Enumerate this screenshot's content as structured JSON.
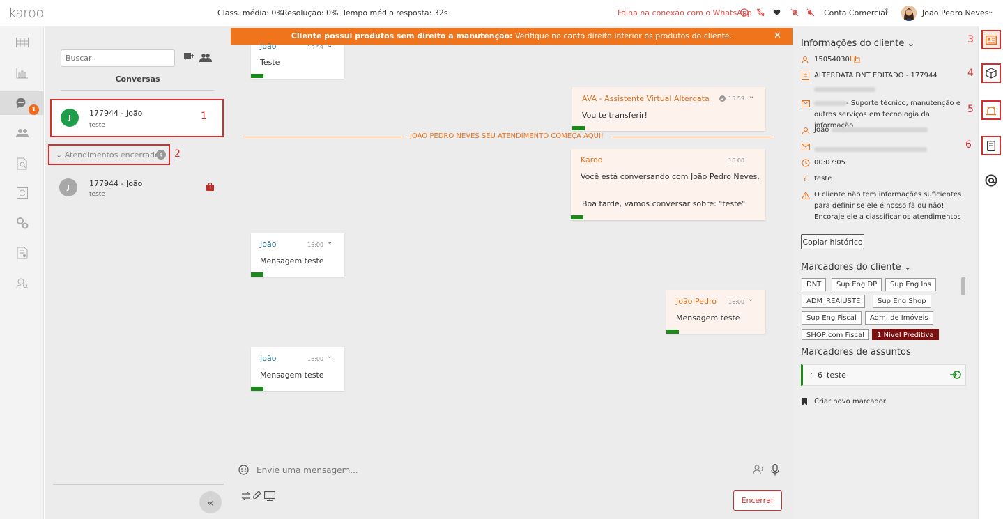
{
  "app": {
    "logo": "karoo"
  },
  "topbar": {
    "stats": [
      {
        "label": "Class. média: 0%"
      },
      {
        "label": "Resolução: 0%"
      },
      {
        "label": "Tempo médio resposta: 32s"
      }
    ],
    "whatsapp_status": "Falha na conexão com o WhatsApp",
    "account": "Conta Comercial",
    "user_name": "João Pedro Neves"
  },
  "nav": {
    "chat_badge": "1"
  },
  "conversations": {
    "search_placeholder": "Buscar",
    "title": "Conversas",
    "active": [
      {
        "avatar": "J",
        "name": "177944 - João",
        "preview": "teste"
      }
    ],
    "closed_label": "Atendimentos encerrados",
    "closed_count": "4",
    "closed": [
      {
        "avatar": "J",
        "name": "177944 - João",
        "preview": "teste"
      }
    ]
  },
  "annotations": [
    "1",
    "2",
    "3",
    "4",
    "5",
    "6"
  ],
  "banner": {
    "bold": "Cliente possui produtos sem direito a manutenção:",
    "text": " Verifique no canto direito inferior os produtos do cliente."
  },
  "messages": [
    {
      "sender": "João",
      "time": "15:59",
      "text": "Teste"
    },
    {
      "sender": "AVA - Assistente Virtual Alterdata",
      "time": "15:59",
      "text": "Vou te transferir!"
    },
    {
      "sender": "Karoo",
      "time": "16:00",
      "line1": "Você está conversando com João Pedro Neves.",
      "line2": "Boa tarde, vamos conversar sobre: \"teste\""
    },
    {
      "sender": "João",
      "time": "16:00",
      "text": "Mensagem teste"
    },
    {
      "sender": "João Pedro",
      "time": "16:00",
      "text": "Mensagem teste"
    },
    {
      "sender": "João",
      "time": "16:00",
      "text": "Mensagem teste"
    }
  ],
  "separator": "JOÃO PEDRO NEVES SEU ATENDIMENTO COMEÇA AQUI!",
  "composer": {
    "placeholder": "Envie uma mensagem...",
    "end_button": "Encerrar"
  },
  "client": {
    "title": "Informações do cliente",
    "code": "15054030",
    "company": "ALTERDATA DNT EDITADO - 177944",
    "service": "- Suporte técnico, manutenção e outros serviços em tecnologia da informação",
    "contact": "João",
    "time": "00:07:05",
    "question": "teste",
    "warning": "O cliente não tem informações suficientes para definir se ele é nosso fã ou não! Encoraje ele a classificar os atendimentos",
    "copy_button": "Copiar histórico",
    "tags_title": "Marcadores do cliente",
    "tags": [
      "DNT",
      "Sup Eng DP",
      "Sup Eng Ins",
      "ADM_REAJUSTE",
      "Sup Eng Shop",
      "Sup Eng Fiscal",
      "Adm. de Imóveis",
      "SHOP com Fiscal",
      "1 Nível Preditiva"
    ],
    "subjects_title": "Marcadores de assuntos",
    "subject_count": "6",
    "subject_label": "teste",
    "new_tag": "Criar novo marcador"
  },
  "colors": {
    "accent": "#f0741b",
    "annotation": "#d32f2f",
    "bar": "#1a8a1a",
    "tag_highlight": "#7a1010"
  }
}
